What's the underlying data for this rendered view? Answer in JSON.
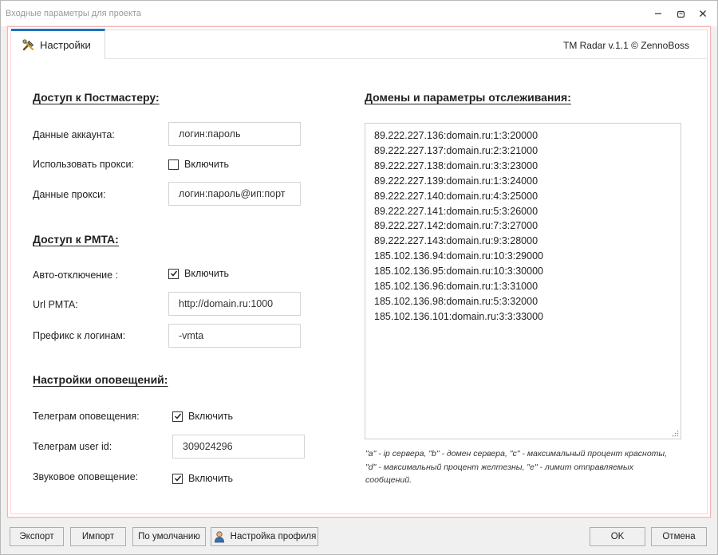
{
  "window": {
    "title": "Входные параметры для проекта"
  },
  "tab": {
    "label": "Настройки",
    "icon": "tools-icon"
  },
  "brand": "TM Radar v.1.1 © ZennoBoss",
  "postmaster": {
    "title": "Доступ к Постмастеру:",
    "account_label": "Данные аккаунта:",
    "account_value": "логин:пароль",
    "use_proxy_label": "Использовать прокси:",
    "use_proxy_checkbox": "Включить",
    "use_proxy_checked": false,
    "proxy_label": "Данные прокси:",
    "proxy_value": "логин:пароль@ип:порт"
  },
  "pmta": {
    "title": "Доступ к PMTA:",
    "auto_off_label": "Авто-отключение :",
    "auto_off_checkbox": "Включить",
    "auto_off_checked": true,
    "url_label": "Url PMTA:",
    "url_value": "http://domain.ru:1000",
    "prefix_label": "Префикс к логинам:",
    "prefix_value": "-vmta"
  },
  "notify": {
    "title": "Настройки оповещений:",
    "telegram_label": "Телеграм оповещения:",
    "telegram_checkbox": "Включить",
    "telegram_checked": true,
    "user_id_label": "Телеграм user id:",
    "user_id_value": "309024296",
    "sound_label": "Звуковое оповещение:",
    "sound_checkbox": "Включить",
    "sound_checked": true
  },
  "domains": {
    "title": "Домены и параметры отслеживания:",
    "lines": [
      "89.222.227.136:domain.ru:1:3:20000",
      "89.222.227.137:domain.ru:2:3:21000",
      "89.222.227.138:domain.ru:3:3:23000",
      "89.222.227.139:domain.ru:1:3:24000",
      "89.222.227.140:domain.ru:4:3:25000",
      "89.222.227.141:domain.ru:5:3:26000",
      "89.222.227.142:domain.ru:7:3:27000",
      "89.222.227.143:domain.ru:9:3:28000",
      "185.102.136.94:domain.ru:10:3:29000",
      "185.102.136.95:domain.ru:10:3:30000",
      "185.102.136.96:domain.ru:1:3:31000",
      "185.102.136.98:domain.ru:5:3:32000",
      "185.102.136.101:domain.ru:3:3:33000"
    ],
    "hint": "\"a\" - ip сервера, \"b\" - домен сервера, \"c\" - максимальный процент красноты, \"d\" - максимальный процент желтезны, \"e\" - лимит отправляемых сообщений."
  },
  "buttons": {
    "export": "Экспорт",
    "import": "Импорт",
    "defaults": "По умолчанию",
    "profile": "Настройка профиля",
    "ok": "OK",
    "cancel": "Отмена"
  },
  "colors": {
    "accent": "#1e73be",
    "panel_border": "#f4b4b4"
  }
}
